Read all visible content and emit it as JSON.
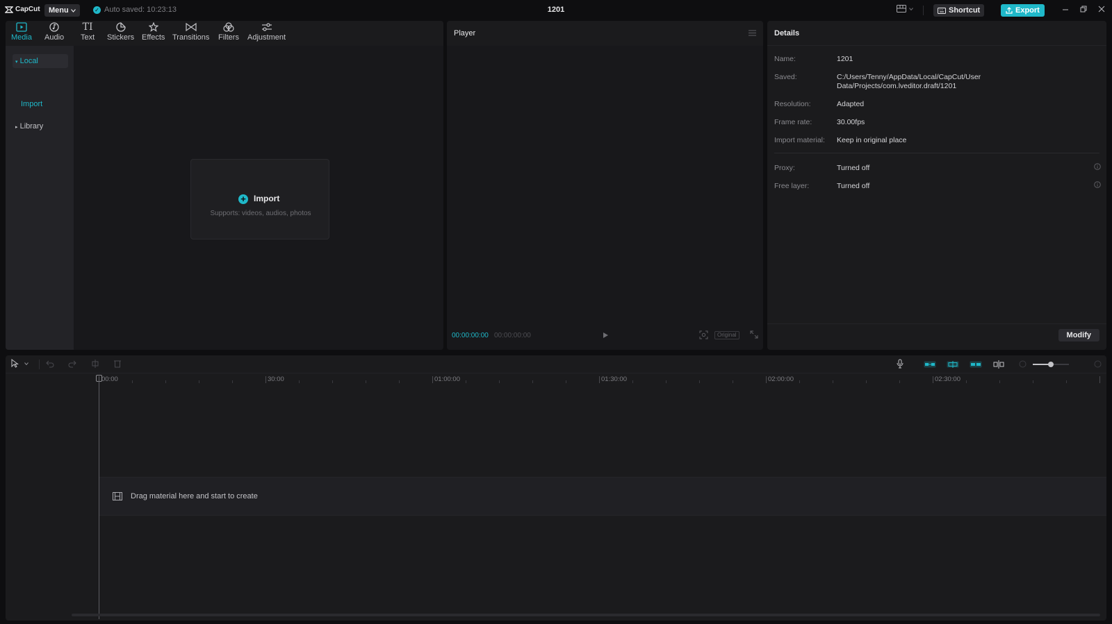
{
  "app": {
    "name": "CapCut",
    "project_title": "1201",
    "autosave": "Auto saved: 10:23:13"
  },
  "titlebar": {
    "menu_label": "Menu",
    "shortcut_label": "Shortcut",
    "export_label": "Export"
  },
  "tabs": [
    {
      "label": "Media",
      "icon": "media-icon",
      "active": true
    },
    {
      "label": "Audio",
      "icon": "audio-icon",
      "active": false
    },
    {
      "label": "Text",
      "icon": "text-icon",
      "active": false
    },
    {
      "label": "Stickers",
      "icon": "sticker-icon",
      "active": false
    },
    {
      "label": "Effects",
      "icon": "effects-icon",
      "active": false
    },
    {
      "label": "Transitions",
      "icon": "transitions-icon",
      "active": false
    },
    {
      "label": "Filters",
      "icon": "filters-icon",
      "active": false
    },
    {
      "label": "Adjustment",
      "icon": "adjustment-icon",
      "active": false
    }
  ],
  "media_sidebar": {
    "local": "Local",
    "import": "Import",
    "library": "Library"
  },
  "import_card": {
    "label": "Import",
    "subtitle": "Supports: videos, audios, photos"
  },
  "player": {
    "title": "Player",
    "current_time": "00:00:00:00",
    "duration": "00:00:00:00",
    "ratio": "Original"
  },
  "details": {
    "title": "Details",
    "rows": [
      {
        "label": "Name:",
        "value": "1201"
      },
      {
        "label": "Saved:",
        "value": "C:/Users/Tenny/AppData/Local/CapCut/User Data/Projects/com.lveditor.draft/1201"
      },
      {
        "label": "Resolution:",
        "value": "Adapted"
      },
      {
        "label": "Frame rate:",
        "value": "30.00fps"
      },
      {
        "label": "Import material:",
        "value": "Keep in original place"
      },
      {
        "label": "Proxy:",
        "value": "Turned off"
      },
      {
        "label": "Free layer:",
        "value": "Turned off"
      }
    ],
    "modify_label": "Modify"
  },
  "timeline": {
    "ruler": [
      "00:00",
      "30:00",
      "01:00:00",
      "01:30:00",
      "02:00:00",
      "02:30:00"
    ],
    "empty_hint": "Drag material here and start to create"
  },
  "colors": {
    "accent": "#1fb8c9",
    "background": "#0e0e10",
    "panel": "#1b1b1d"
  }
}
